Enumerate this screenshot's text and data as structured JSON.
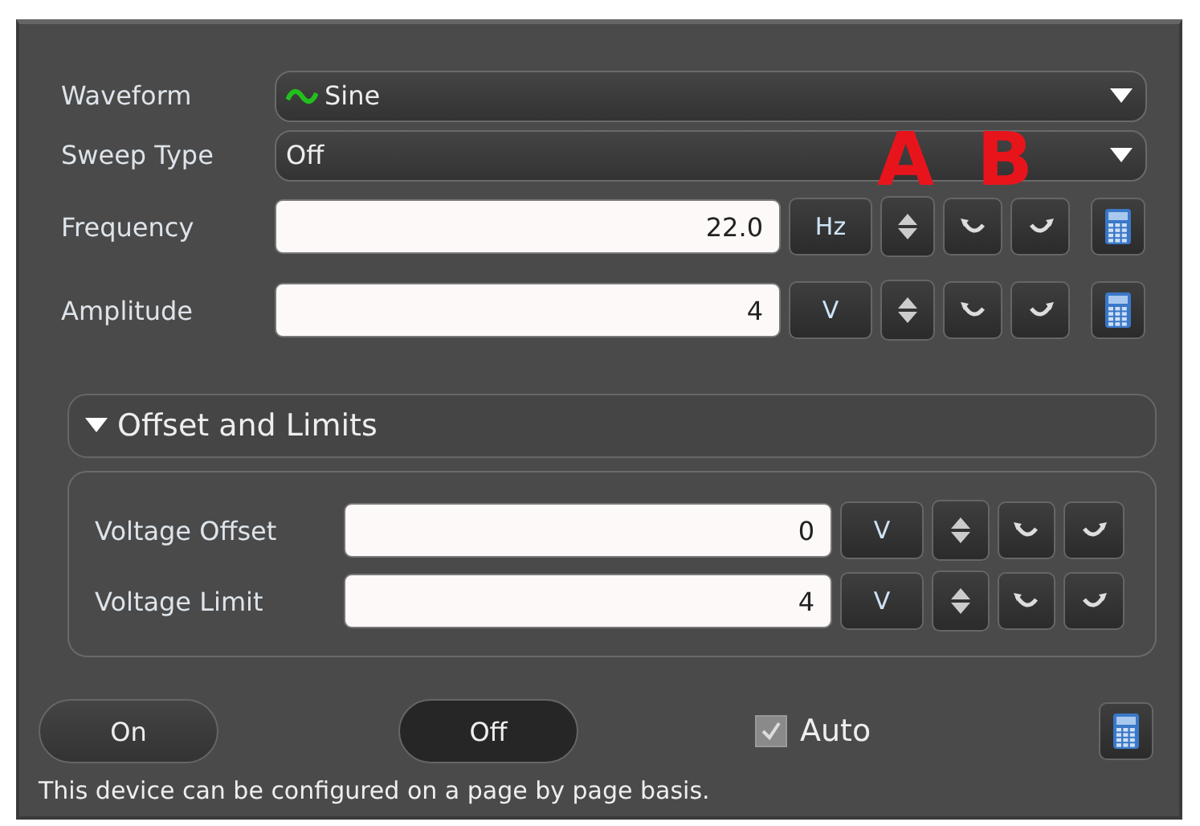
{
  "rows": [
    {
      "kind": "select",
      "label": "Waveform",
      "value": "Sine",
      "wave_icon": true
    },
    {
      "kind": "select",
      "label": "Sweep Type",
      "value": "Off",
      "wave_icon": false,
      "annotations": [
        "A",
        "B"
      ]
    },
    {
      "kind": "number",
      "label": "Frequency",
      "value": "22.0",
      "unit": "Hz"
    },
    {
      "kind": "number",
      "label": "Amplitude",
      "value": "4",
      "unit": "V"
    }
  ],
  "section": {
    "title": "Offset and Limits",
    "expanded": true,
    "rows": [
      {
        "label": "Voltage Offset",
        "value": "0",
        "unit": "V"
      },
      {
        "label": "Voltage Limit",
        "value": "4",
        "unit": "V"
      }
    ]
  },
  "power_buttons": [
    {
      "label": "On",
      "selected": false
    },
    {
      "label": "Off",
      "selected": true
    }
  ],
  "auto": {
    "label": "Auto",
    "checked": true
  },
  "note": "This device can be configured on a page by page basis."
}
